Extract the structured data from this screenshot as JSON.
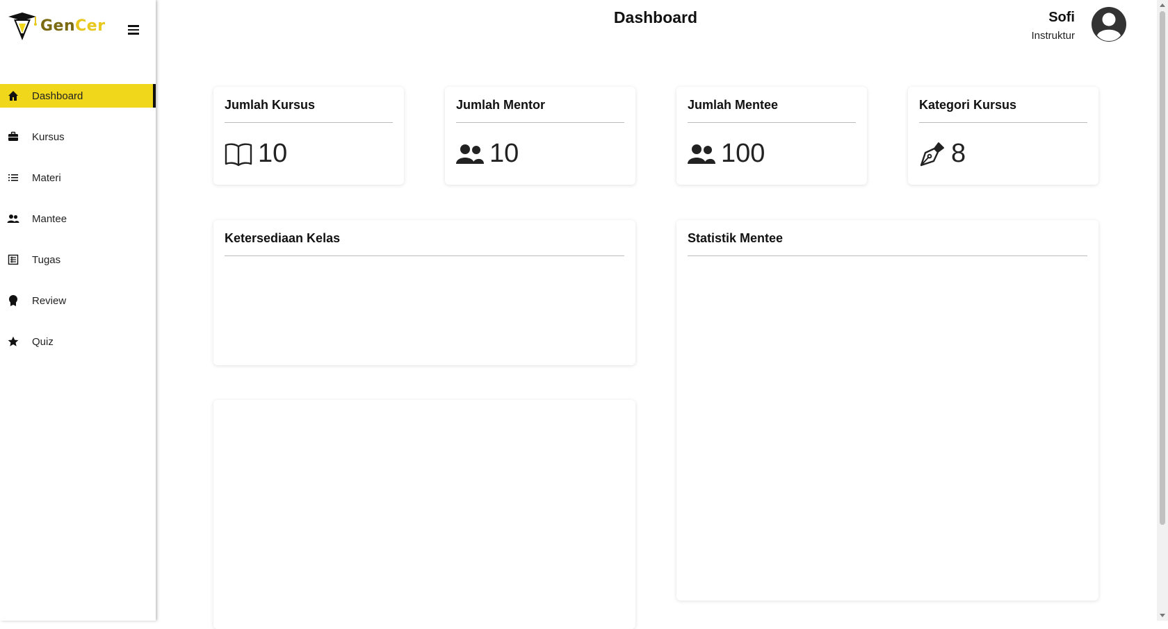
{
  "app": {
    "logo_text_part1": "Gen",
    "logo_text_part2": "Cer"
  },
  "header": {
    "title": "Dashboard",
    "user_name": "Sofi",
    "user_role": "Instruktur"
  },
  "sidebar": {
    "items": [
      {
        "label": "Dashboard",
        "icon": "home-icon",
        "active": true
      },
      {
        "label": "Kursus",
        "icon": "briefcase-icon"
      },
      {
        "label": "Materi",
        "icon": "list-icon"
      },
      {
        "label": "Mantee",
        "icon": "users-icon"
      },
      {
        "label": "Tugas",
        "icon": "table-icon"
      },
      {
        "label": "Review",
        "icon": "award-icon"
      },
      {
        "label": "Quiz",
        "icon": "star-icon"
      }
    ]
  },
  "stats": [
    {
      "title": "Jumlah Kursus",
      "value": "10",
      "icon": "book-icon"
    },
    {
      "title": "Jumlah Mentor",
      "value": "10",
      "icon": "users-icon"
    },
    {
      "title": "Jumlah Mentee",
      "value": "100",
      "icon": "users-icon"
    },
    {
      "title": "Kategori Kursus",
      "value": "8",
      "icon": "pen-icon"
    }
  ],
  "panels": {
    "availability_title": "Ketersediaan Kelas",
    "statistics_title": "Statistik Mentee"
  },
  "colors": {
    "accent": "#f0d71c",
    "logo_dark": "#7a6a12",
    "logo_light": "#e8c81d"
  }
}
